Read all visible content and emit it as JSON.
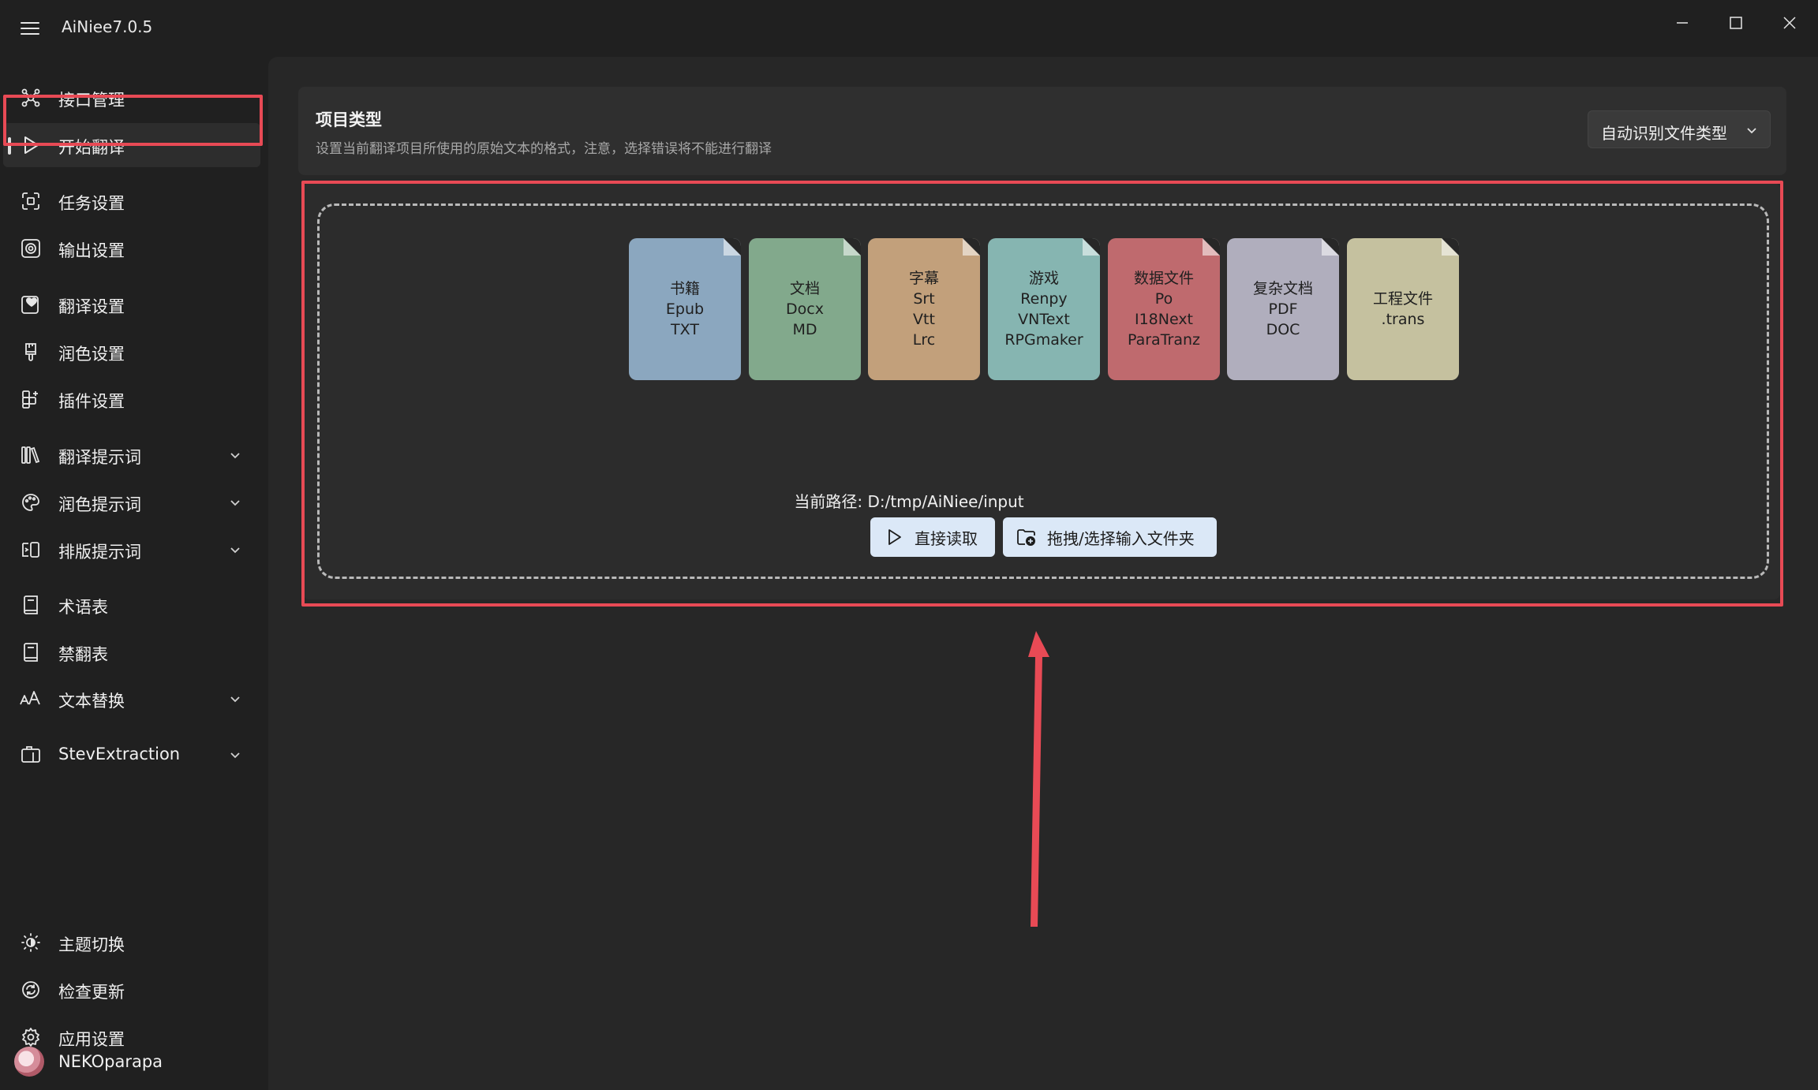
{
  "window": {
    "title": "AiNiee7.0.5"
  },
  "sidebar": {
    "items": [
      {
        "label": "接口管理",
        "icon": "network-icon"
      },
      {
        "label": "开始翻译",
        "icon": "play-icon"
      },
      {
        "label": "任务设置",
        "icon": "task-settings-icon"
      },
      {
        "label": "输出设置",
        "icon": "output-icon"
      },
      {
        "label": "翻译设置",
        "icon": "heart-icon"
      },
      {
        "label": "润色设置",
        "icon": "brush-icon"
      },
      {
        "label": "插件设置",
        "icon": "apps-add-icon"
      },
      {
        "label": "翻译提示词",
        "icon": "library-icon"
      },
      {
        "label": "润色提示词",
        "icon": "palette-icon"
      },
      {
        "label": "排版提示词",
        "icon": "layout-icon"
      },
      {
        "label": "术语表",
        "icon": "book-icon"
      },
      {
        "label": "禁翻表",
        "icon": "book-icon"
      },
      {
        "label": "文本替换",
        "icon": "text-replace-icon"
      },
      {
        "label": "StevExtraction",
        "icon": "extract-icon"
      }
    ],
    "bottom": [
      {
        "label": "主题切换",
        "icon": "brightness-icon"
      },
      {
        "label": "检查更新",
        "icon": "sync-icon"
      },
      {
        "label": "应用设置",
        "icon": "gear-icon"
      }
    ],
    "user": {
      "name": "NEKOparapa"
    }
  },
  "project_type": {
    "title": "项目类型",
    "description": "设置当前翻译项目所使用的原始文本的格式，注意，选择错误将不能进行翻译",
    "selected": "自动识别文件类型"
  },
  "file_types": [
    {
      "lines": [
        "书籍",
        "Epub",
        "TXT"
      ],
      "color": "#8ba7bf"
    },
    {
      "lines": [
        "文档",
        "Docx",
        "MD"
      ],
      "color": "#82a98c"
    },
    {
      "lines": [
        "字幕",
        "Srt",
        "Vtt",
        "Lrc"
      ],
      "color": "#c2a07b"
    },
    {
      "lines": [
        "游戏",
        "Renpy",
        "VNText",
        "RPGmaker"
      ],
      "color": "#86b5b1"
    },
    {
      "lines": [
        "数据文件",
        "Po",
        "I18Next",
        "ParaTranz"
      ],
      "color": "#bf6a6e"
    },
    {
      "lines": [
        "复杂文档",
        "PDF",
        "DOC"
      ],
      "color": "#b0aebd"
    },
    {
      "lines": [
        "工程文件",
        ".trans"
      ],
      "color": "#c5c19f"
    }
  ],
  "input": {
    "current_path": "当前路径: D:/tmp/AiNiee/input",
    "read_button": "直接读取",
    "select_button": "拖拽/选择输入文件夹"
  },
  "colors": {
    "annotation": "#e84a55",
    "button_bg": "#dbe8f7"
  }
}
